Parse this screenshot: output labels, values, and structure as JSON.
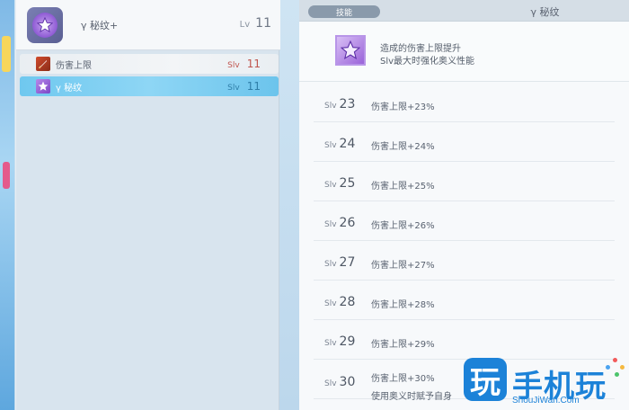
{
  "left_panel": {
    "header": {
      "title": "γ 秘纹+",
      "lv_label": "Lv",
      "lv_value": "11"
    },
    "skills": [
      {
        "label": "伤害上限",
        "slv_label": "Slv",
        "slv_value": "11",
        "icon": "sword-icon",
        "selected": false
      },
      {
        "label": "γ 秘纹",
        "slv_label": "Slv",
        "slv_value": "11",
        "icon": "star-icon",
        "selected": true
      }
    ]
  },
  "right_panel": {
    "tag": "技能",
    "title": "γ 秘纹",
    "description": {
      "line1": "造成的伤害上限提升",
      "line2": "Slv最大时强化奥义性能"
    },
    "levels": [
      {
        "slv_label": "Slv",
        "level": "23",
        "effect": "伤害上限+23%"
      },
      {
        "slv_label": "Slv",
        "level": "24",
        "effect": "伤害上限+24%"
      },
      {
        "slv_label": "Slv",
        "level": "25",
        "effect": "伤害上限+25%"
      },
      {
        "slv_label": "Slv",
        "level": "26",
        "effect": "伤害上限+26%"
      },
      {
        "slv_label": "Slv",
        "level": "27",
        "effect": "伤害上限+27%"
      },
      {
        "slv_label": "Slv",
        "level": "28",
        "effect": "伤害上限+28%"
      },
      {
        "slv_label": "Slv",
        "level": "29",
        "effect": "伤害上限+29%"
      },
      {
        "slv_label": "Slv",
        "level": "30",
        "effect": "伤害上限+30%",
        "effect2": "使用奥义时赋予自身"
      }
    ]
  },
  "watermark": {
    "logo_char": "玩",
    "text": "手机玩",
    "url": "ShouJiWan.Com"
  },
  "colors": {
    "accent_blue": "#6fc8ef",
    "slv_red": "#c0554e",
    "watermark_blue": "#1c82d8"
  }
}
